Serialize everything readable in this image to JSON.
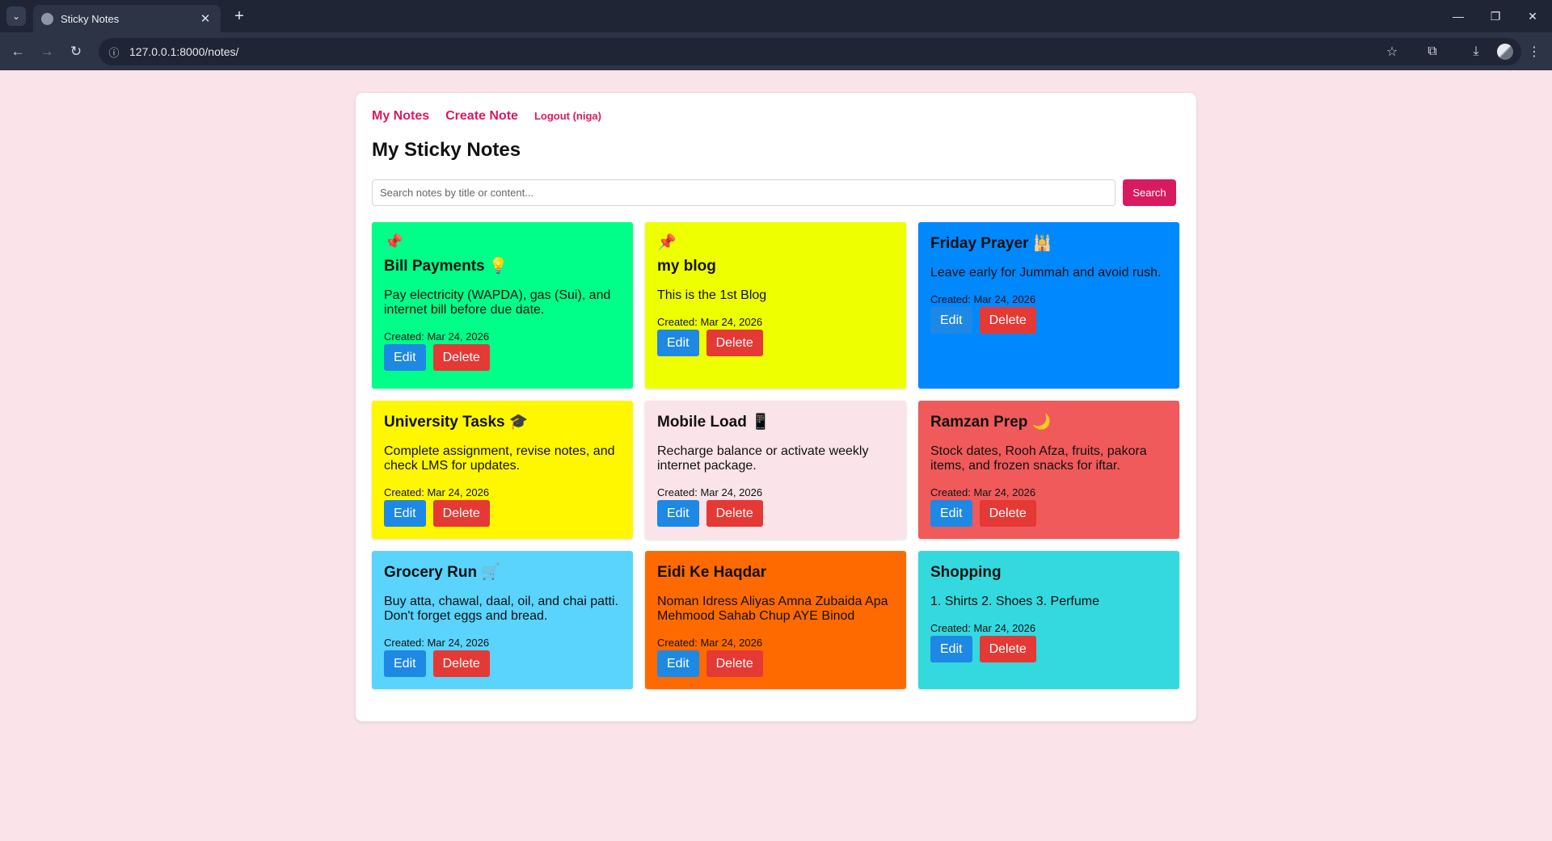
{
  "browser": {
    "tab_title": "Sticky Notes",
    "url": "127.0.0.1:8000/notes/"
  },
  "nav": {
    "my_notes": "My Notes",
    "create_note": "Create Note",
    "logout": "Logout (niga)"
  },
  "page": {
    "title": "My Sticky Notes"
  },
  "search": {
    "placeholder": "Search notes by title or content...",
    "button": "Search"
  },
  "labels": {
    "edit": "Edit",
    "delete": "Delete"
  },
  "notes": [
    {
      "pinned": true,
      "pin_icon": "📌",
      "title": "Bill Payments 💡",
      "content": "Pay electricity (WAPDA), gas (Sui), and internet bill before due date.",
      "created": "Created: Mar 24, 2026",
      "color": "#00ff88"
    },
    {
      "pinned": true,
      "pin_icon": "📌",
      "title": "my blog",
      "content": "This is the 1st Blog",
      "created": "Created: Mar 24, 2026",
      "color": "#eeff00"
    },
    {
      "pinned": false,
      "title": "Friday Prayer 🕌",
      "content": "Leave early for Jummah and avoid rush.",
      "created": "Created: Mar 24, 2026",
      "color": "#0088ff"
    },
    {
      "pinned": false,
      "title": "University Tasks 🎓",
      "content": "Complete assignment, revise notes, and check LMS for updates.",
      "created": "Created: Mar 24, 2026",
      "color": "#fff700"
    },
    {
      "pinned": false,
      "title": "Mobile Load 📱",
      "content": "Recharge balance or activate weekly internet package.",
      "created": "Created: Mar 24, 2026",
      "color": "#fbe3ea"
    },
    {
      "pinned": false,
      "title": "Ramzan Prep 🌙",
      "content": "Stock dates, Rooh Afza, fruits, pakora items, and frozen snacks for iftar.",
      "created": "Created: Mar 24, 2026",
      "color": "#f05a5a"
    },
    {
      "pinned": false,
      "title": "Grocery Run 🛒",
      "content": "Buy atta, chawal, daal, oil, and chai patti. Don't forget eggs and bread.",
      "created": "Created: Mar 24, 2026",
      "color": "#5ad3fd"
    },
    {
      "pinned": false,
      "title": "Eidi Ke Haqdar",
      "content": "Noman Idress Aliyas Amna Zubaida Apa Mehmood Sahab Chup AYE Binod",
      "created": "Created: Mar 24, 2026",
      "color": "#ff6a00"
    },
    {
      "pinned": false,
      "title": "Shopping",
      "content": "1. Shirts 2. Shoes 3. Perfume",
      "created": "Created: Mar 24, 2026",
      "color": "#33d9de"
    }
  ]
}
